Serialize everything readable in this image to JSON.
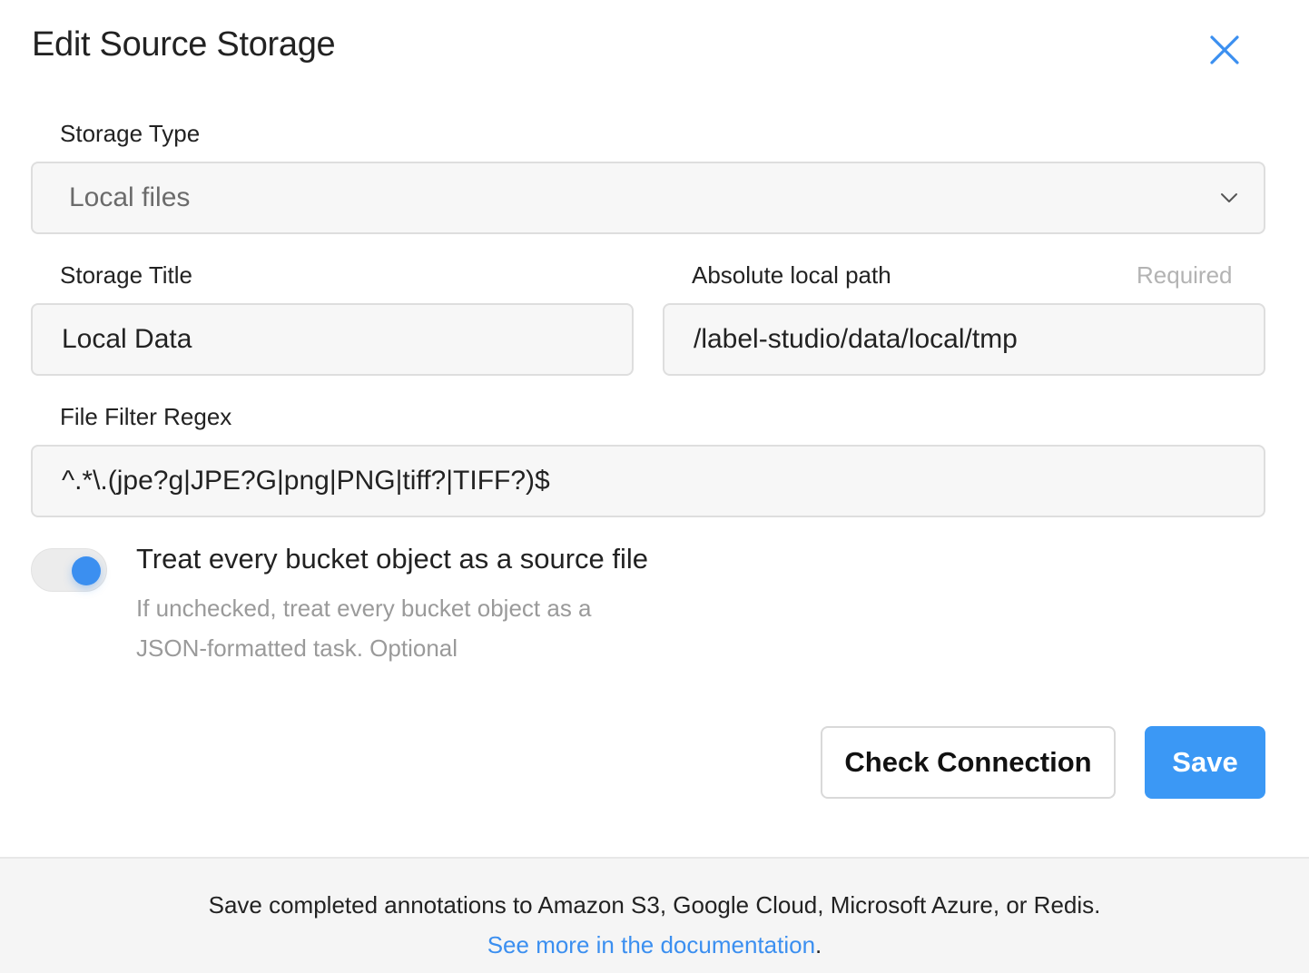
{
  "dialog": {
    "title": "Edit Source Storage",
    "close_icon": "close-icon"
  },
  "form": {
    "storage_type": {
      "label": "Storage Type",
      "value": "Local files",
      "icon": "chevron-down-icon"
    },
    "storage_title": {
      "label": "Storage Title",
      "value": "Local Data"
    },
    "local_path": {
      "label": "Absolute local path",
      "hint": "Required",
      "value": "/label-studio/data/local/tmp"
    },
    "regex": {
      "label": "File Filter Regex",
      "value": "^.*\\.(jpe?g|JPE?G|png|PNG|tiff?|TIFF?)$"
    },
    "toggle": {
      "checked": true,
      "title": "Treat every bucket object as a source file",
      "desc_line1": "If unchecked, treat every bucket object as a",
      "desc_line2": "JSON-formatted task. Optional"
    }
  },
  "actions": {
    "check_label": "Check Connection",
    "save_label": "Save"
  },
  "footer": {
    "text": "Save completed annotations to Amazon S3, Google Cloud, Microsoft Azure, or Redis.",
    "link_text": "See more in the documentation",
    "link_suffix": "."
  },
  "colors": {
    "accent": "#3b98f5",
    "link": "#3b8ff0"
  }
}
